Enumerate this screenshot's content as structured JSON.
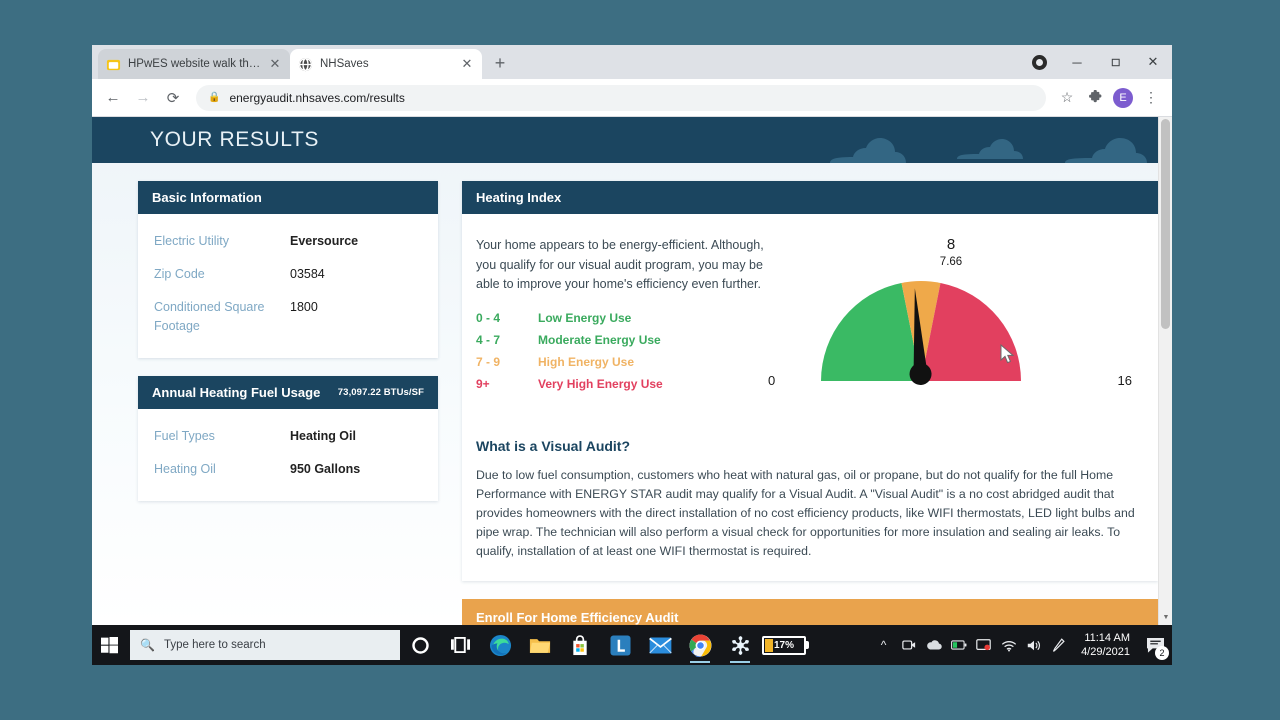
{
  "browser": {
    "tabs": [
      {
        "label": "HPwES website walk through - G",
        "favicon": "folder-icon",
        "active": false
      },
      {
        "label": "NHSaves",
        "favicon": "globe-icon",
        "active": true
      }
    ],
    "new_tab_label": "+",
    "window_controls": {
      "update": "update-dot",
      "minimize": "─",
      "maximize": "❐",
      "close": "✕"
    },
    "nav": {
      "back": "←",
      "forward": "→",
      "reload": "⟳",
      "lock": "🔒",
      "url": "energyaudit.nhsaves.com/results",
      "bookmark": "☆",
      "extensions": "puzzle-icon",
      "profile_initial": "E",
      "menu": "⋮"
    }
  },
  "page": {
    "banner_title": "YOUR RESULTS",
    "basic_information": {
      "title": "Basic Information",
      "rows": [
        {
          "key": "Electric Utility",
          "value": "Eversource",
          "bold": true
        },
        {
          "key": "Zip Code",
          "value": "03584",
          "bold": false
        },
        {
          "key": "Conditioned Square Footage",
          "value": "1800",
          "bold": false
        }
      ]
    },
    "fuel_usage": {
      "title": "Annual Heating Fuel Usage",
      "subtitle": "73,097.22 BTUs/SF",
      "rows": [
        {
          "key": "Fuel Types",
          "value": "Heating Oil",
          "bold": true
        },
        {
          "key": "Heating Oil",
          "value": "950 Gallons",
          "bold": true
        }
      ]
    },
    "heating_index": {
      "title": "Heating Index",
      "paragraph": "Your home appears to be energy-efficient. Although, you qualify for our visual audit program, you may be able to improve your home's efficiency even further.",
      "legend": [
        {
          "range": "0 - 4",
          "label": "Low Energy Use",
          "color": "#3aaa5e"
        },
        {
          "range": "4 - 7",
          "label": "Moderate Energy Use",
          "color": "#3aaa5e"
        },
        {
          "range": "7 - 9",
          "label": "High Energy Use",
          "color": "#f0b364"
        },
        {
          "range": "9+",
          "label": "Very High Energy Use",
          "color": "#e2405f"
        }
      ]
    },
    "visual_audit": {
      "heading": "What is a Visual Audit?",
      "body": "Due to low fuel consumption, customers who heat with natural gas, oil or propane, but do not qualify for the full Home Performance with ENERGY STAR audit may qualify for a Visual Audit. A \"Visual Audit\" is a no cost abridged audit that provides homeowners with the direct installation of no cost efficiency products, like WIFI thermostats, LED light bulbs and pipe wrap. The technician will also perform a visual check for opportunities for more insulation and sealing air leaks. To qualify, installation of at least one WIFI thermostat is required."
    },
    "enroll_button": "Enroll For Home Efficiency Audit"
  },
  "chart_data": {
    "type": "gauge",
    "title": "Heating Index",
    "value": 7.66,
    "value_label": "7.66",
    "min": 0,
    "max": 16,
    "min_label": "0",
    "max_label": "16",
    "top_tick_label": "8",
    "bands": [
      {
        "from": 0,
        "to": 7,
        "color": "#3aba64",
        "name": "Low / Moderate Energy Use"
      },
      {
        "from": 7,
        "to": 9,
        "color": "#efa94a",
        "name": "High Energy Use"
      },
      {
        "from": 9,
        "to": 16,
        "color": "#e2405f",
        "name": "Very High Energy Use"
      }
    ],
    "needle_color": "#111111",
    "legend_position": "left"
  },
  "taskbar": {
    "start": "windows-logo",
    "search_placeholder": "Type here to search",
    "items": [
      {
        "name": "cortana-icon"
      },
      {
        "name": "task-view-icon"
      },
      {
        "name": "edge-icon"
      },
      {
        "name": "file-explorer-icon"
      },
      {
        "name": "microsoft-store-icon"
      },
      {
        "name": "lastpass-icon"
      },
      {
        "name": "mail-icon"
      },
      {
        "name": "chrome-icon"
      },
      {
        "name": "snowflake-app-icon"
      }
    ],
    "battery_percent": "17%",
    "battery_level": 17,
    "tray": [
      {
        "name": "show-hidden-icons-chevron"
      },
      {
        "name": "teams-icon"
      },
      {
        "name": "onedrive-icon"
      },
      {
        "name": "battery-tray-icon"
      },
      {
        "name": "display-icon"
      },
      {
        "name": "wifi-icon"
      },
      {
        "name": "volume-icon"
      },
      {
        "name": "bluetooth-pen-icon"
      }
    ],
    "clock_time": "11:14 AM",
    "clock_date": "4/29/2021",
    "notification_count": "2"
  }
}
